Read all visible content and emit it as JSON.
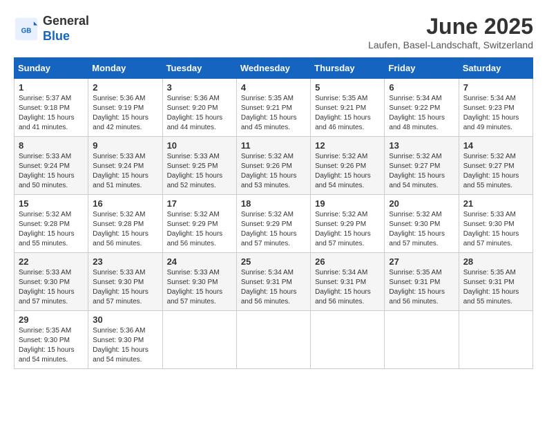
{
  "header": {
    "logo_general": "General",
    "logo_blue": "Blue",
    "month_title": "June 2025",
    "subtitle": "Laufen, Basel-Landschaft, Switzerland"
  },
  "days_of_week": [
    "Sunday",
    "Monday",
    "Tuesday",
    "Wednesday",
    "Thursday",
    "Friday",
    "Saturday"
  ],
  "weeks": [
    [
      {
        "day": "1",
        "info": "Sunrise: 5:37 AM\nSunset: 9:18 PM\nDaylight: 15 hours\nand 41 minutes."
      },
      {
        "day": "2",
        "info": "Sunrise: 5:36 AM\nSunset: 9:19 PM\nDaylight: 15 hours\nand 42 minutes."
      },
      {
        "day": "3",
        "info": "Sunrise: 5:36 AM\nSunset: 9:20 PM\nDaylight: 15 hours\nand 44 minutes."
      },
      {
        "day": "4",
        "info": "Sunrise: 5:35 AM\nSunset: 9:21 PM\nDaylight: 15 hours\nand 45 minutes."
      },
      {
        "day": "5",
        "info": "Sunrise: 5:35 AM\nSunset: 9:21 PM\nDaylight: 15 hours\nand 46 minutes."
      },
      {
        "day": "6",
        "info": "Sunrise: 5:34 AM\nSunset: 9:22 PM\nDaylight: 15 hours\nand 48 minutes."
      },
      {
        "day": "7",
        "info": "Sunrise: 5:34 AM\nSunset: 9:23 PM\nDaylight: 15 hours\nand 49 minutes."
      }
    ],
    [
      {
        "day": "8",
        "info": "Sunrise: 5:33 AM\nSunset: 9:24 PM\nDaylight: 15 hours\nand 50 minutes."
      },
      {
        "day": "9",
        "info": "Sunrise: 5:33 AM\nSunset: 9:24 PM\nDaylight: 15 hours\nand 51 minutes."
      },
      {
        "day": "10",
        "info": "Sunrise: 5:33 AM\nSunset: 9:25 PM\nDaylight: 15 hours\nand 52 minutes."
      },
      {
        "day": "11",
        "info": "Sunrise: 5:32 AM\nSunset: 9:26 PM\nDaylight: 15 hours\nand 53 minutes."
      },
      {
        "day": "12",
        "info": "Sunrise: 5:32 AM\nSunset: 9:26 PM\nDaylight: 15 hours\nand 54 minutes."
      },
      {
        "day": "13",
        "info": "Sunrise: 5:32 AM\nSunset: 9:27 PM\nDaylight: 15 hours\nand 54 minutes."
      },
      {
        "day": "14",
        "info": "Sunrise: 5:32 AM\nSunset: 9:27 PM\nDaylight: 15 hours\nand 55 minutes."
      }
    ],
    [
      {
        "day": "15",
        "info": "Sunrise: 5:32 AM\nSunset: 9:28 PM\nDaylight: 15 hours\nand 55 minutes."
      },
      {
        "day": "16",
        "info": "Sunrise: 5:32 AM\nSunset: 9:28 PM\nDaylight: 15 hours\nand 56 minutes."
      },
      {
        "day": "17",
        "info": "Sunrise: 5:32 AM\nSunset: 9:29 PM\nDaylight: 15 hours\nand 56 minutes."
      },
      {
        "day": "18",
        "info": "Sunrise: 5:32 AM\nSunset: 9:29 PM\nDaylight: 15 hours\nand 57 minutes."
      },
      {
        "day": "19",
        "info": "Sunrise: 5:32 AM\nSunset: 9:29 PM\nDaylight: 15 hours\nand 57 minutes."
      },
      {
        "day": "20",
        "info": "Sunrise: 5:32 AM\nSunset: 9:30 PM\nDaylight: 15 hours\nand 57 minutes."
      },
      {
        "day": "21",
        "info": "Sunrise: 5:33 AM\nSunset: 9:30 PM\nDaylight: 15 hours\nand 57 minutes."
      }
    ],
    [
      {
        "day": "22",
        "info": "Sunrise: 5:33 AM\nSunset: 9:30 PM\nDaylight: 15 hours\nand 57 minutes."
      },
      {
        "day": "23",
        "info": "Sunrise: 5:33 AM\nSunset: 9:30 PM\nDaylight: 15 hours\nand 57 minutes."
      },
      {
        "day": "24",
        "info": "Sunrise: 5:33 AM\nSunset: 9:30 PM\nDaylight: 15 hours\nand 57 minutes."
      },
      {
        "day": "25",
        "info": "Sunrise: 5:34 AM\nSunset: 9:31 PM\nDaylight: 15 hours\nand 56 minutes."
      },
      {
        "day": "26",
        "info": "Sunrise: 5:34 AM\nSunset: 9:31 PM\nDaylight: 15 hours\nand 56 minutes."
      },
      {
        "day": "27",
        "info": "Sunrise: 5:35 AM\nSunset: 9:31 PM\nDaylight: 15 hours\nand 56 minutes."
      },
      {
        "day": "28",
        "info": "Sunrise: 5:35 AM\nSunset: 9:31 PM\nDaylight: 15 hours\nand 55 minutes."
      }
    ],
    [
      {
        "day": "29",
        "info": "Sunrise: 5:35 AM\nSunset: 9:30 PM\nDaylight: 15 hours\nand 54 minutes."
      },
      {
        "day": "30",
        "info": "Sunrise: 5:36 AM\nSunset: 9:30 PM\nDaylight: 15 hours\nand 54 minutes."
      },
      {
        "day": "",
        "info": ""
      },
      {
        "day": "",
        "info": ""
      },
      {
        "day": "",
        "info": ""
      },
      {
        "day": "",
        "info": ""
      },
      {
        "day": "",
        "info": ""
      }
    ]
  ]
}
